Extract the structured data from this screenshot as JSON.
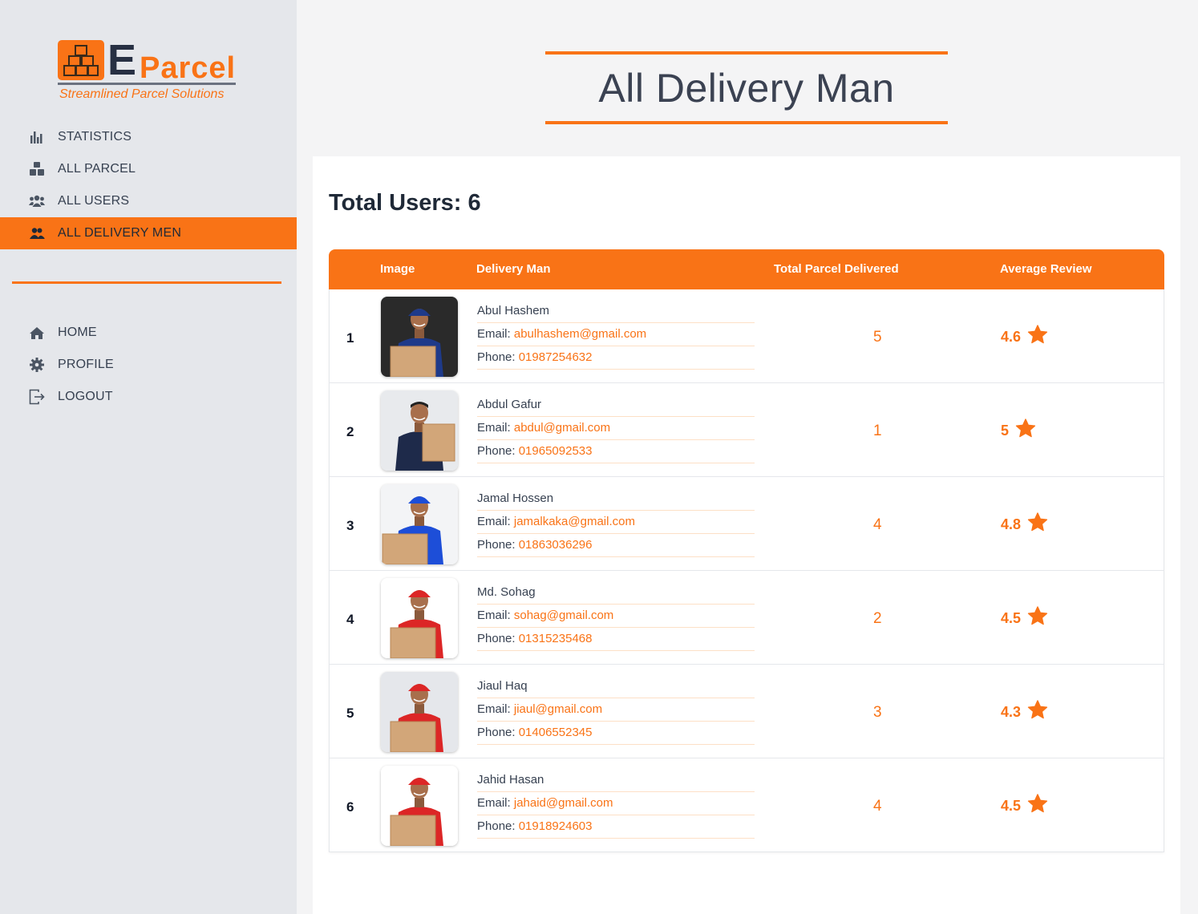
{
  "brand": {
    "letter": "E",
    "name": "Parcel",
    "tagline": "Streamlined Parcel Solutions"
  },
  "sidebar": {
    "items_top": [
      {
        "label": "STATISTICS",
        "icon": "bar-chart-icon"
      },
      {
        "label": "ALL PARCEL",
        "icon": "boxes-icon"
      },
      {
        "label": "ALL USERS",
        "icon": "users-icon"
      },
      {
        "label": "ALL DELIVERY MEN",
        "icon": "delivery-men-icon",
        "active": true
      }
    ],
    "items_bottom": [
      {
        "label": "HOME",
        "icon": "home-icon"
      },
      {
        "label": "PROFILE",
        "icon": "gear-icon"
      },
      {
        "label": "LOGOUT",
        "icon": "logout-icon"
      }
    ]
  },
  "page": {
    "title": "All Delivery Man",
    "total_users": "Total Users: 6"
  },
  "table": {
    "headers": [
      "Image",
      "Delivery Man",
      "Total Parcel Delivered",
      "Average Review"
    ],
    "email_label": "Email:",
    "phone_label": "Phone:",
    "rows": [
      {
        "index": "1",
        "name": "Abul Hashem",
        "email": "abulhashem@gmail.com",
        "phone": "01987254632",
        "delivered": "5",
        "review": "4.6"
      },
      {
        "index": "2",
        "name": "Abdul Gafur",
        "email": "abdul@gmail.com",
        "phone": "01965092533",
        "delivered": "1",
        "review": "5"
      },
      {
        "index": "3",
        "name": "Jamal Hossen",
        "email": "jamalkaka@gmail.com",
        "phone": "01863036296",
        "delivered": "4",
        "review": "4.8"
      },
      {
        "index": "4",
        "name": "Md. Sohag",
        "email": "sohag@gmail.com",
        "phone": "01315235468",
        "delivered": "2",
        "review": "4.5"
      },
      {
        "index": "5",
        "name": "Jiaul Haq",
        "email": "jiaul@gmail.com",
        "phone": "01406552345",
        "delivered": "3",
        "review": "4.3"
      },
      {
        "index": "6",
        "name": "Jahid Hasan",
        "email": "jahaid@gmail.com",
        "phone": "01918924603",
        "delivered": "4",
        "review": "4.5"
      }
    ]
  },
  "colors": {
    "accent": "#f97316",
    "sidebar_bg": "#e5e7eb",
    "page_bg": "#f4f4f5",
    "text_dark": "#374151"
  }
}
